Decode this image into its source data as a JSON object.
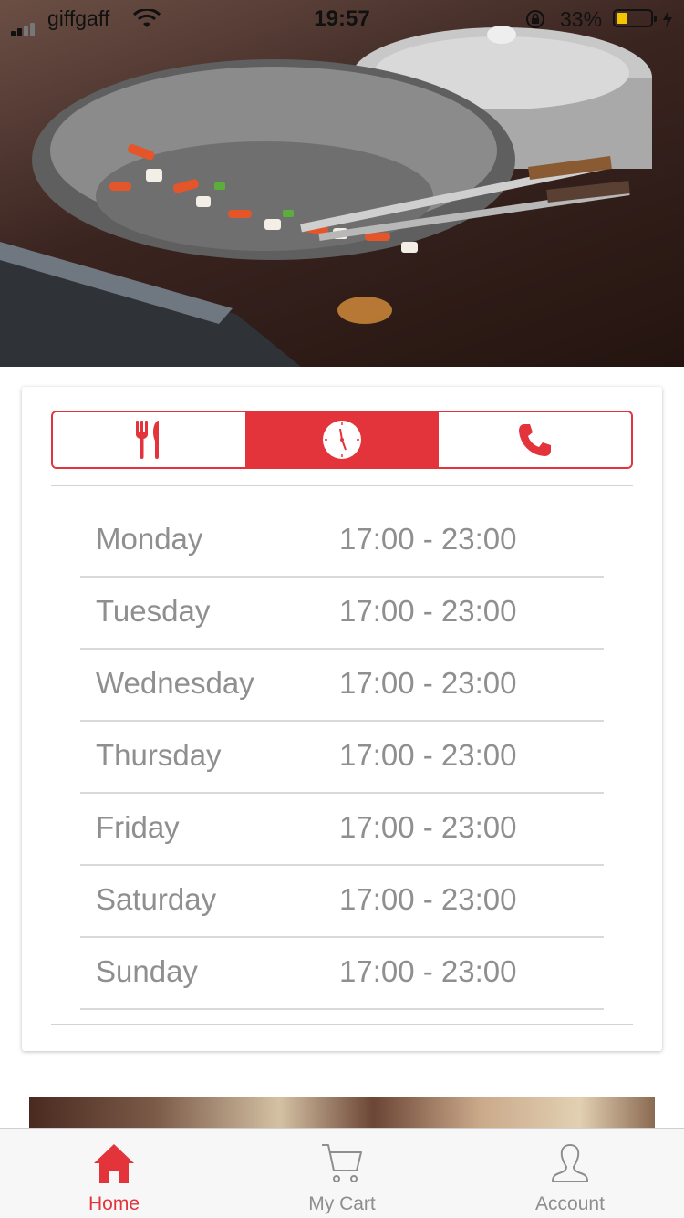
{
  "status_bar": {
    "carrier": "giffgaff",
    "time": "19:57",
    "battery_percent": "33%",
    "battery_level": 0.33
  },
  "segments": [
    {
      "icon": "cutlery-icon",
      "active": false
    },
    {
      "icon": "clock-icon",
      "active": true
    },
    {
      "icon": "phone-icon",
      "active": false
    }
  ],
  "opening_hours": [
    {
      "day": "Monday",
      "hours": "17:00 - 23:00"
    },
    {
      "day": "Tuesday",
      "hours": "17:00 - 23:00"
    },
    {
      "day": "Wednesday",
      "hours": "17:00 - 23:00"
    },
    {
      "day": "Thursday",
      "hours": "17:00 - 23:00"
    },
    {
      "day": "Friday",
      "hours": "17:00 - 23:00"
    },
    {
      "day": "Saturday",
      "hours": "17:00 - 23:00"
    },
    {
      "day": "Sunday",
      "hours": "17:00 - 23:00"
    }
  ],
  "tab_bar": {
    "items": [
      {
        "label": "Home",
        "icon": "home-icon",
        "active": true
      },
      {
        "label": "My Cart",
        "icon": "cart-icon",
        "active": false
      },
      {
        "label": "Account",
        "icon": "user-icon",
        "active": false
      }
    ]
  },
  "colors": {
    "accent": "#e3343c",
    "text_muted": "#8f8f8f",
    "battery": "#f5c400"
  }
}
